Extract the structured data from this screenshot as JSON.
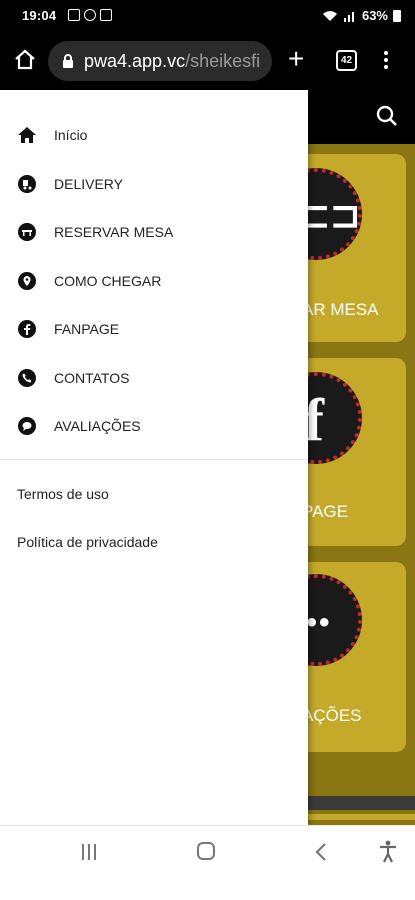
{
  "status_bar": {
    "time": "19:04",
    "battery": "63%"
  },
  "browser": {
    "url_host": "pwa4.app.vc",
    "url_path": "/sheikesfi",
    "tab_count": "42"
  },
  "drawer": {
    "items": [
      {
        "label": "Início",
        "icon": "home-icon"
      },
      {
        "label": "DELIVERY",
        "icon": "delivery-icon"
      },
      {
        "label": "RESERVAR MESA",
        "icon": "reservation-icon"
      },
      {
        "label": "COMO CHEGAR",
        "icon": "location-pin-icon"
      },
      {
        "label": "FANPAGE",
        "icon": "facebook-icon"
      },
      {
        "label": "CONTATOS",
        "icon": "phone-icon"
      },
      {
        "label": "AVALIAÇÕES",
        "icon": "chat-bubble-icon"
      }
    ],
    "legal": {
      "terms": "Termos de uso",
      "privacy": "Política de privacidade"
    }
  },
  "background_page": {
    "card_labels": [
      "AR MESA",
      "PAGE",
      "AÇÕES"
    ],
    "accent_color": "#c5aa2a",
    "badge_ring_color": "#c0282d"
  }
}
